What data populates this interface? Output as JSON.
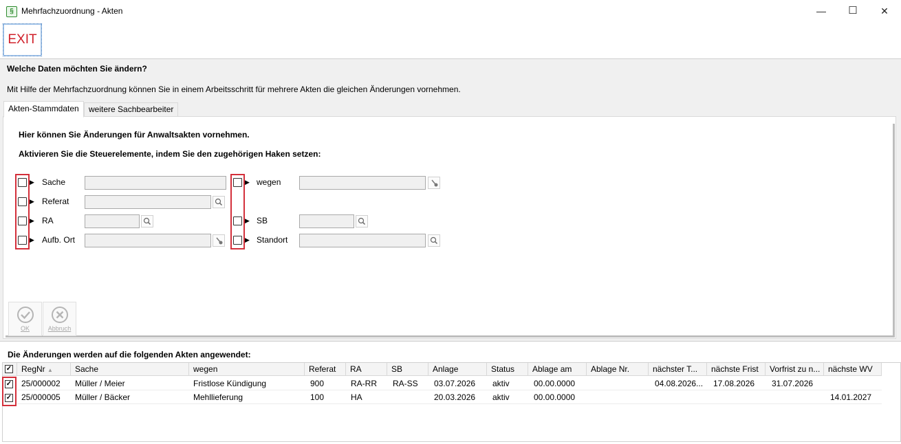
{
  "window": {
    "title": "Mehrfachzuordnung - Akten",
    "app_icon": "§",
    "minimize": "—",
    "maximize": "☐",
    "close": "✕"
  },
  "toolbar": {
    "exit_label": "EXIT"
  },
  "header": {
    "question": "Welche Daten möchten Sie ändern?",
    "info": "Mit Hilfe der Mehrfachzuordnung können Sie in einem Arbeitsschritt für mehrere Akten die gleichen Änderungen vornehmen."
  },
  "tabs": [
    {
      "label": "Akten-Stammdaten"
    },
    {
      "label": "weitere Sachbearbeiter"
    }
  ],
  "panel": {
    "intro": "Hier können Sie Änderungen für Anwaltsakten vornehmen.",
    "instruction": "Aktivieren Sie die Steuerelemente, indem Sie den zugehörigen Haken setzen:",
    "left_fields": [
      {
        "label": "Sache"
      },
      {
        "label": "Referat"
      },
      {
        "label": "RA"
      },
      {
        "label": "Aufb. Ort"
      }
    ],
    "right_fields": [
      {
        "label": "wegen"
      },
      {
        "label": "SB"
      },
      {
        "label": "Standort"
      }
    ],
    "ok_label": "OK",
    "cancel_label": "Abbruch",
    "highlight_color": "#d32f3a"
  },
  "grid": {
    "caption": "Die Änderungen werden auf die folgenden Akten angewendet:",
    "columns": [
      "RegNr",
      "Sache",
      "wegen",
      "Referat",
      "RA",
      "SB",
      "Anlage",
      "Status",
      "Ablage am",
      "Ablage Nr.",
      "nächster T...",
      "nächste Frist",
      "Vorfrist zu n...",
      "nächste WV"
    ],
    "sort_indicator": "▲",
    "rows": [
      [
        "25/000002",
        "Müller / Meier",
        "Fristlose Kündigung",
        "900",
        "RA-RR",
        "RA-SS",
        "03.07.2026",
        "aktiv",
        "00.00.0000",
        "",
        "04.08.2026...",
        "17.08.2026",
        "31.07.2026",
        ""
      ],
      [
        "25/000005",
        "Müller / Bäcker",
        "Mehllieferung",
        "100",
        "HA",
        "",
        "20.03.2026",
        "aktiv",
        "00.00.0000",
        "",
        "",
        "",
        "",
        "14.01.2027"
      ]
    ],
    "checkmark": "✓"
  }
}
